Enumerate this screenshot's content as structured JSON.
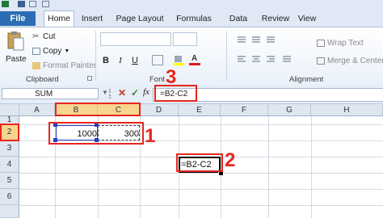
{
  "ribbon": {
    "tabs": [
      "File",
      "Home",
      "Insert",
      "Page Layout",
      "Formulas",
      "Data",
      "Review",
      "View"
    ],
    "clipboard": {
      "paste_label": "Paste",
      "cut_label": "Cut",
      "copy_label": "Copy",
      "format_painter_label": "Format Painter",
      "group_label": "Clipboard"
    },
    "font": {
      "bold": "B",
      "italic": "I",
      "underline": "U",
      "group_label": "Font"
    },
    "alignment": {
      "wrap_text_label": "Wrap Text",
      "merge_label": "Merge & Center",
      "group_label": "Alignment"
    }
  },
  "formula_bar": {
    "name_box": "SUM",
    "fx_label": "fx",
    "formula": "=B2-C2"
  },
  "sheet": {
    "columns": [
      "A",
      "B",
      "C",
      "D",
      "E",
      "F",
      "G",
      "H"
    ],
    "rows": [
      "1",
      "2",
      "3",
      "4",
      "5",
      "6"
    ],
    "cells": {
      "B2": "1000",
      "C2": "300",
      "E4": "=B2-C2"
    }
  },
  "annotations": {
    "one": "1",
    "two": "2",
    "three": "3"
  },
  "colors": {
    "file_tab": "#2a6db3",
    "annotation": "#e8261f",
    "selected_header": "#f8d58f"
  }
}
